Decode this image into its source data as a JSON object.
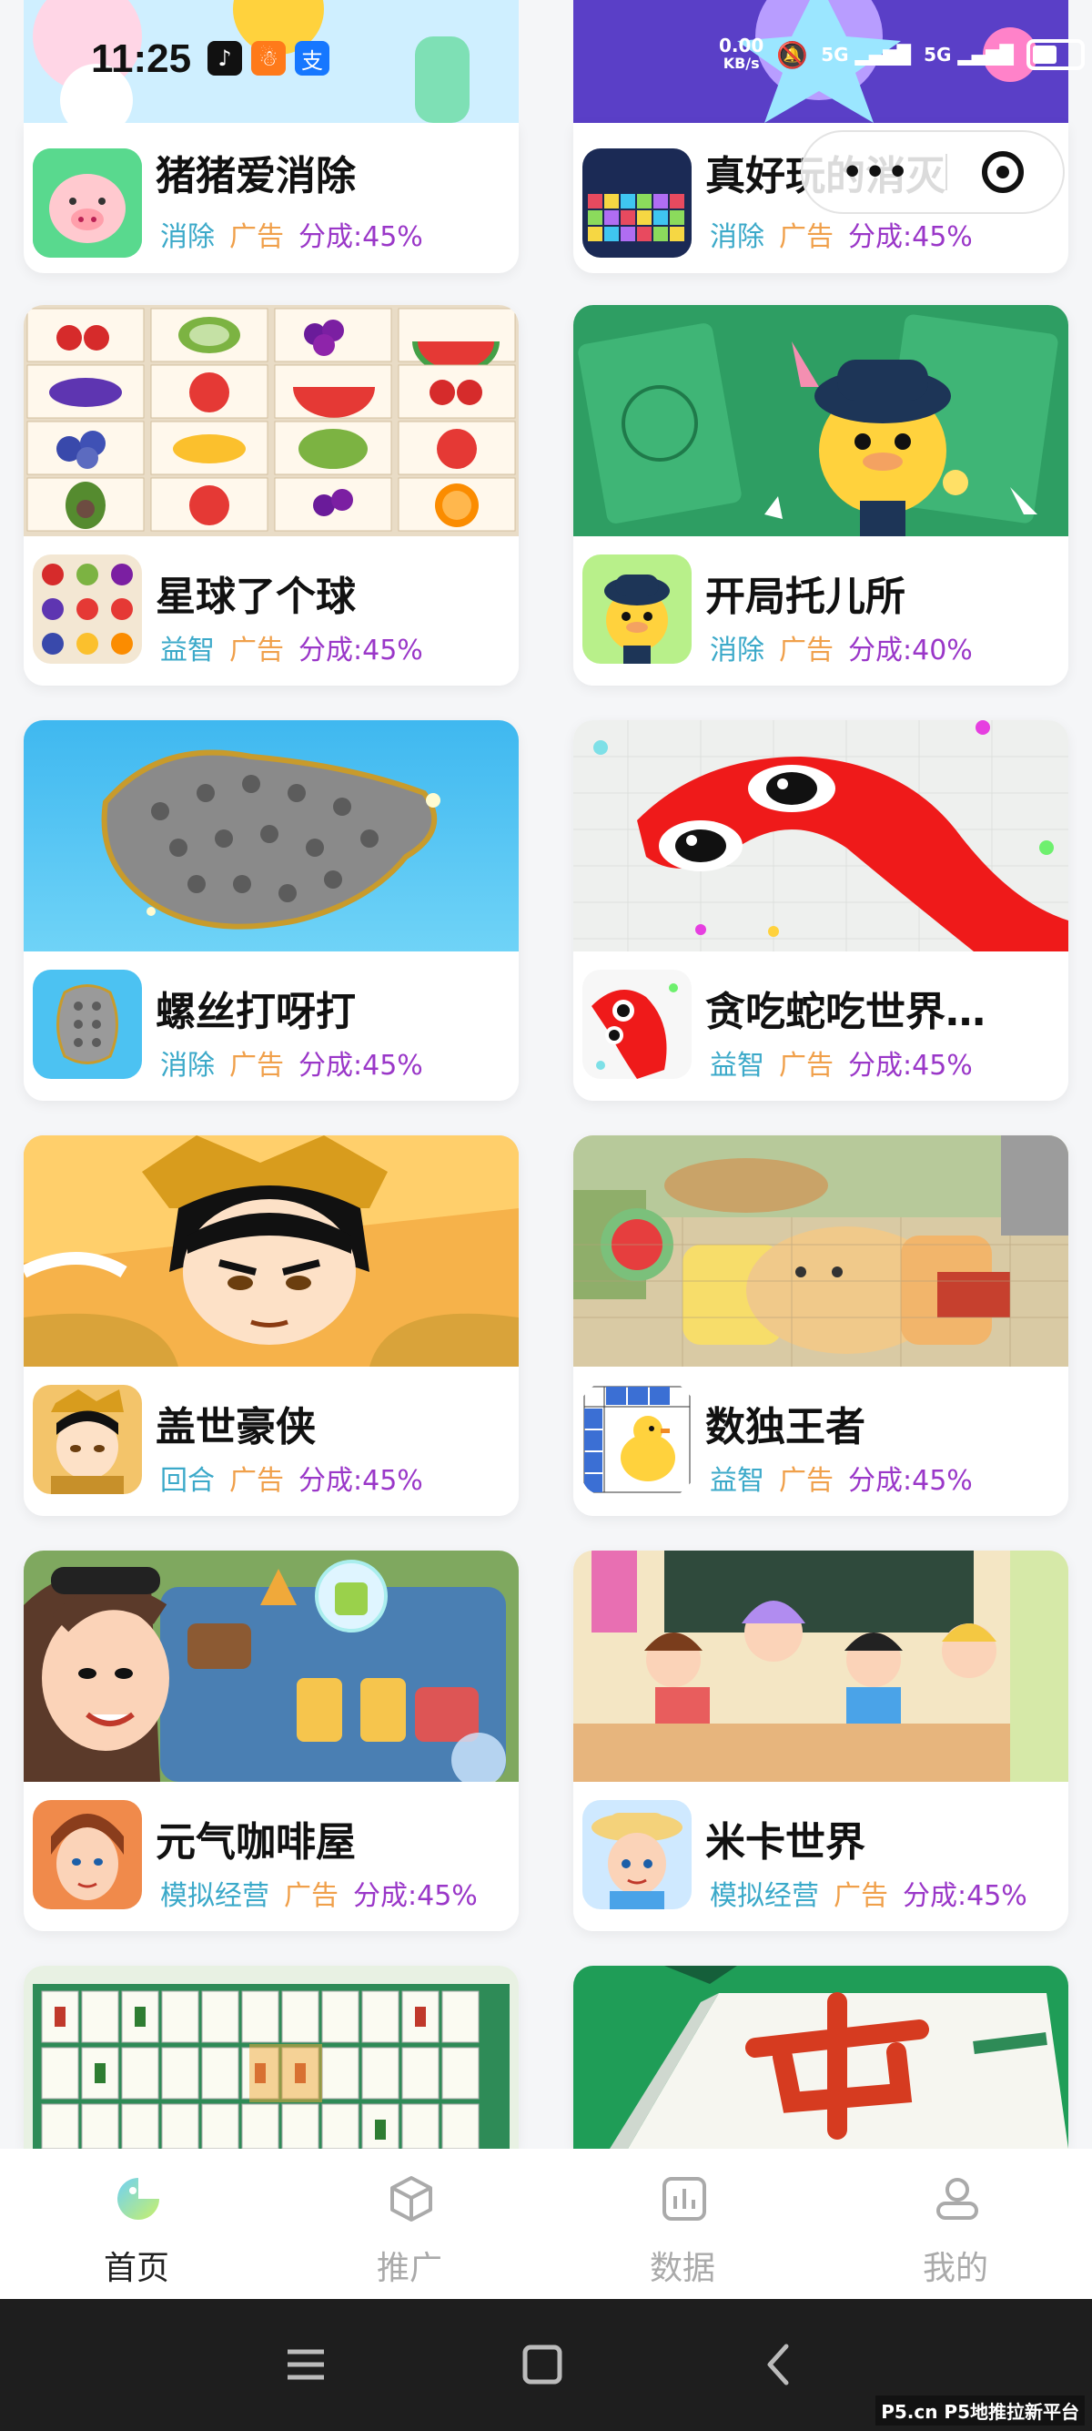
{
  "status_bar": {
    "time": "11:25",
    "speed_value": "0.00",
    "speed_unit": "KB/s",
    "network_1": "5G",
    "network_2": "5G"
  },
  "capsule": {
    "more_icon": "more-dots-icon",
    "close_icon": "close-target-icon"
  },
  "games": [
    {
      "name": "猪猪爱消除",
      "category": "消除",
      "ad": "广告",
      "share": "分成:45%"
    },
    {
      "name": "真好玩的消灭",
      "category": "消除",
      "ad": "广告",
      "share": "分成:45%"
    },
    {
      "name": "星球了个球",
      "category": "益智",
      "ad": "广告",
      "share": "分成:45%"
    },
    {
      "name": "开局托儿所",
      "category": "消除",
      "ad": "广告",
      "share": "分成:40%"
    },
    {
      "name": "螺丝打呀打",
      "category": "消除",
      "ad": "广告",
      "share": "分成:45%"
    },
    {
      "name": "贪吃蛇吃世界…",
      "category": "益智",
      "ad": "广告",
      "share": "分成:45%"
    },
    {
      "name": "盖世豪侠",
      "category": "回合",
      "ad": "广告",
      "share": "分成:45%"
    },
    {
      "name": "数独王者",
      "category": "益智",
      "ad": "广告",
      "share": "分成:45%"
    },
    {
      "name": "元气咖啡屋",
      "category": "模拟经营",
      "ad": "广告",
      "share": "分成:45%"
    },
    {
      "name": "米卡世界",
      "category": "模拟经营",
      "ad": "广告",
      "share": "分成:45%"
    }
  ],
  "bottom_nav": {
    "home": "首页",
    "promote": "推广",
    "data": "数据",
    "mine": "我的"
  },
  "watermark": "P5.cn P5地推拉新平台",
  "colors": {
    "category": "#3ba9c9",
    "ad": "#f0a04b",
    "share": "#9a37c8"
  }
}
